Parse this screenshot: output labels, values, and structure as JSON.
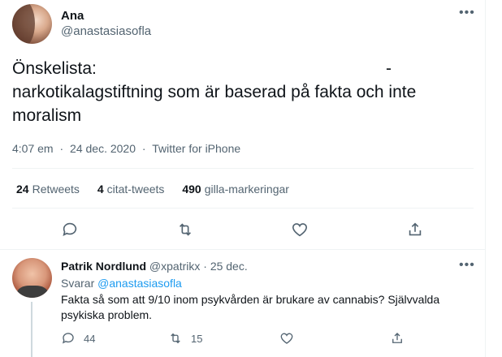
{
  "tweet": {
    "author_name": "Ana",
    "author_handle": "@anastasiasofla",
    "line1": "Önskelista:",
    "dash": "-",
    "line2": "narkotikalagstiftning som är baserad på fakta och inte",
    "line3": "moralism",
    "time": "4:07 em",
    "date": "24 dec. 2020",
    "source": "Twitter for iPhone",
    "sep": "·",
    "more_glyph": "•••"
  },
  "stats": {
    "retweets_count": "24",
    "retweets_label": "Retweets",
    "quotes_count": "4",
    "quotes_label": "citat-tweets",
    "likes_count": "490",
    "likes_label": "gilla-markeringar"
  },
  "reply": {
    "author_name": "Patrik Nordlund",
    "author_handle": "@xpatrikx",
    "date": "25 dec.",
    "replying_prefix": "Svarar",
    "replying_to": "@anastasiasofla",
    "line1": "Fakta så som att 9/10 inom psykvården är brukare av cannabis? Självvalda",
    "line2": "psykiska problem.",
    "reply_count": "44",
    "retweet_count": "15",
    "more_glyph": "•••"
  },
  "icons": {
    "reply": "comment-icon",
    "retweet": "retweet-icon",
    "like": "heart-icon",
    "share": "share-icon"
  },
  "colors": {
    "link": "#1d9bf0",
    "secondary_text": "#536471",
    "border": "#eff3f4"
  }
}
